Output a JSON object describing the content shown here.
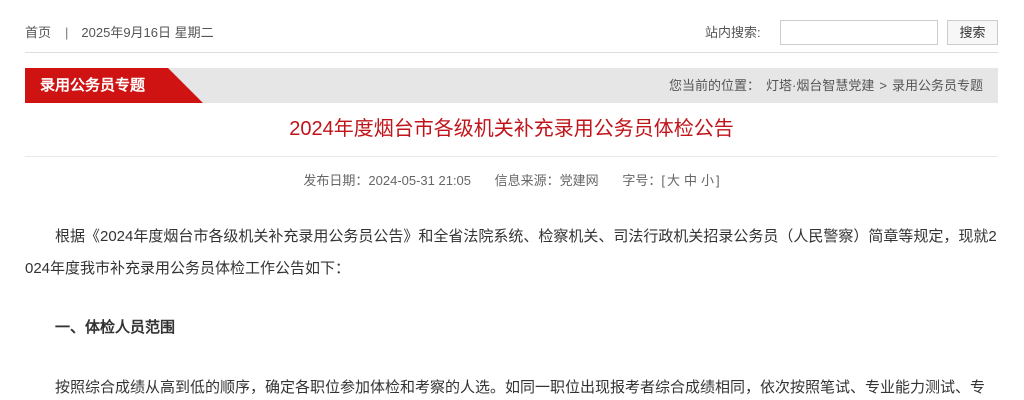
{
  "topbar": {
    "home": "首页",
    "separator": "|",
    "date": "2025年9月16日 星期二",
    "search_label": "站内搜索:",
    "search_value": "",
    "search_button": "搜索"
  },
  "banner": {
    "tab_label": "录用公务员专题",
    "location_label": "您当前的位置：",
    "breadcrumb": [
      "灯塔·烟台智慧党建",
      "录用公务员专题"
    ],
    "breadcrumb_separator": ">"
  },
  "article": {
    "title": "2024年度烟台市各级机关补充录用公务员体检公告",
    "meta": {
      "publish_label": "发布日期：",
      "publish_date": "2024-05-31 21:05",
      "source_label": "信息来源：",
      "source": "党建网",
      "fontsize_label": "字号：",
      "fontsize_open": "[",
      "sizes": [
        "大",
        "中",
        "小"
      ],
      "fontsize_close": "]"
    },
    "intro": "根据《2024年度烟台市各级机关补充录用公务员公告》和全省法院系统、检察机关、司法行政机关招录公务员（人民警察）简章等规定，现就2024年度我市补充录用公务员体检工作公告如下：",
    "section_heading": "一、体检人员范围",
    "section_text": "按照综合成绩从高到低的顺序，确定各职位参加体检和考察的人选。如同一职位出现报考者综合成绩相同，依次按照笔试、专业能力测试、专"
  },
  "colors": {
    "brand_red": "#cf1313",
    "title_red": "#c0141a",
    "banner_gray": "#e6e6e6",
    "text": "#333333"
  }
}
